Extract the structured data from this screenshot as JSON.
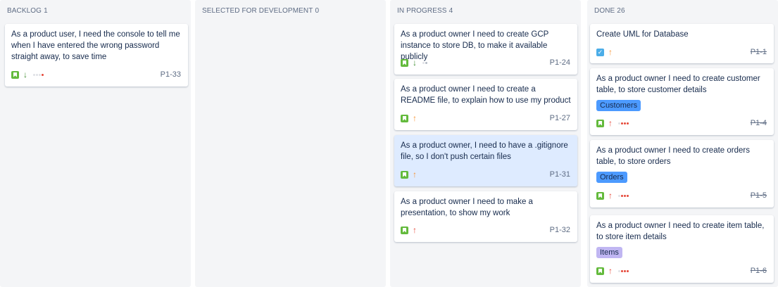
{
  "colors": {
    "story": "#63ba3c",
    "task": "#4bade8",
    "priority_high": "#e5493a",
    "priority_medium": "#f79232",
    "priority_low": "#3d8d2f",
    "epic_customers": "#4c9aff",
    "epic_orders": "#4c9aff",
    "epic_items": "#c0b6f2",
    "highlight": "#deebff"
  },
  "columns": [
    {
      "title": "BACKLOG",
      "count": "1",
      "cards": [
        {
          "title": "As a product user, I need the console to tell me when I have entered the wrong password straight away, to save time",
          "key": "P1-33",
          "type_icon": "story-icon",
          "priority_icon": "arrow-down-icon"
        }
      ]
    },
    {
      "title": "SELECTED FOR DEVELOPMENT",
      "count": "0",
      "cards": []
    },
    {
      "title": "IN PROGRESS",
      "count": "4",
      "cards": [
        {
          "title": "As a product owner I need to create GCP instance to store DB, to make it available publicly",
          "key": "P1-24",
          "type_icon": "story-icon",
          "priority_icon": "arrow-down-icon"
        },
        {
          "title": "As a product owner I need to create a README file, to explain how to use my product",
          "key": "P1-27",
          "type_icon": "story-icon",
          "priority_icon": "arrow-up-icon"
        },
        {
          "title": "As a product owner, I need to have a .gitignore file, so I don't push certain files",
          "key": "P1-31",
          "type_icon": "story-icon",
          "priority_icon": "arrow-up-icon"
        },
        {
          "title": "As a product owner I need to make a presentation, to show my work",
          "key": "P1-32",
          "type_icon": "story-icon",
          "priority_icon": "arrow-up-icon"
        }
      ]
    },
    {
      "title": "DONE",
      "count": "26",
      "cards": [
        {
          "title": "Create UML for Database",
          "key": "P1-1",
          "type_icon": "task-icon",
          "priority_icon": "arrow-up-icon"
        },
        {
          "title": "As a product owner I need to create customer table, to store customer details",
          "key": "P1-4",
          "epic": "Customers",
          "type_icon": "story-icon",
          "priority_icon": "arrow-up-icon"
        },
        {
          "title": "As a product owner I need to create orders table, to store orders",
          "key": "P1-5",
          "epic": "Orders",
          "type_icon": "story-icon",
          "priority_icon": "arrow-up-icon"
        },
        {
          "title": "As a product owner I need to create item table, to store item details",
          "key": "P1-6",
          "epic": "Items",
          "type_icon": "story-icon",
          "priority_icon": "arrow-up-icon"
        }
      ]
    }
  ]
}
